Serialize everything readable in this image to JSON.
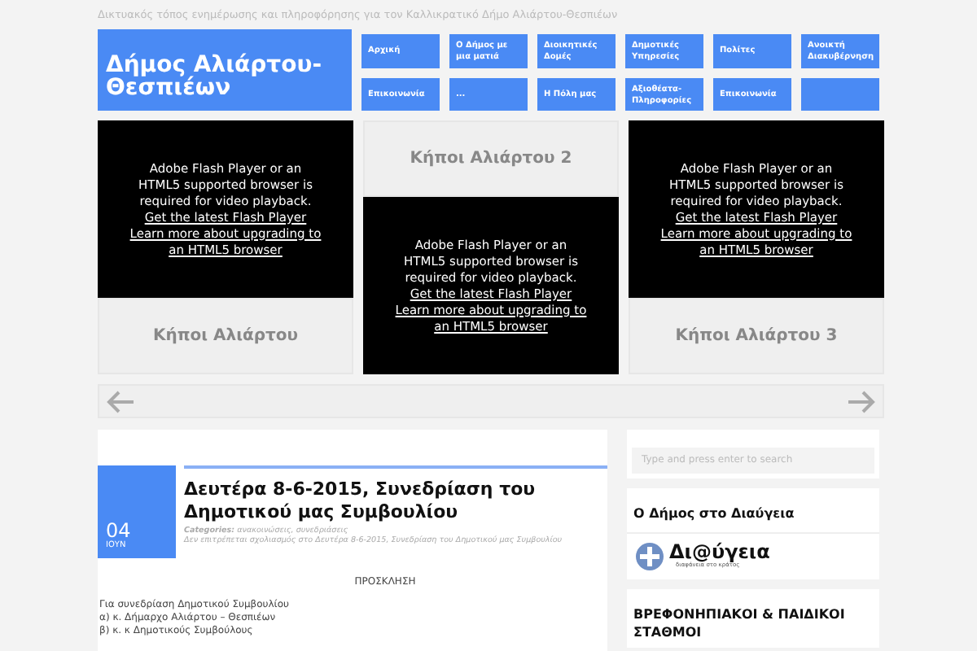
{
  "tagline": "Δικτυακός τόπος ενημέρωσης και πληροφόρησης για τον Καλλικρατικό Δήμο Αλιάρτου-Θεσπιέων",
  "site_title": "Δήμος Αλιάρτου-Θεσπιέων",
  "menu": [
    {
      "kind": "link",
      "label": "Αρχική"
    },
    {
      "kind": "link",
      "label": "Ο Δήμος με μια ματιά"
    },
    {
      "kind": "link",
      "label": "Διοικητικές Δομές"
    },
    {
      "kind": "link",
      "label": "Δημοτικές Υπηρεσίες"
    },
    {
      "kind": "link",
      "label": "Πολίτες"
    },
    {
      "kind": "link",
      "label": "Ανοικτή Διακυβέρνηση"
    },
    {
      "kind": "link",
      "label": "Επικοινωνία"
    },
    {
      "kind": "link",
      "label": "..."
    },
    {
      "kind": "link",
      "label": "Η Πόλη μας"
    },
    {
      "kind": "link",
      "label": "Αξιοθέατα-Πληροφορίες"
    },
    {
      "kind": "link",
      "label": "Επικοινωνία"
    },
    {
      "kind": "blank"
    }
  ],
  "slides": [
    {
      "title": "Κήποι Αλιάρτου",
      "kind": "below",
      "player": {
        "message": "Adobe Flash Player or an HTML5 supported browser is required for video playback.",
        "link_1": "Get the latest Flash Player",
        "link_2": "Learn more about upgrading to an HTML5 browser"
      }
    },
    {
      "title": "Κήποι Αλιάρτου 2",
      "kind": "above",
      "player": {
        "message": "Adobe Flash Player or an HTML5 supported browser is required for video playback.",
        "link_1": "Get the latest Flash Player",
        "link_2": "Learn more about upgrading to an HTML5 browser"
      }
    },
    {
      "title": "Κήποι Αλιάρτου 3",
      "kind": "below",
      "player": {
        "message": "Adobe Flash Player or an HTML5 supported browser is required for video playback.",
        "link_1": "Get the latest Flash Player",
        "link_2": "Learn more about upgrading to an HTML5 browser"
      }
    }
  ],
  "post": {
    "day": "04",
    "month": "ΙΟΥΝ",
    "title": "Δευτέρα 8-6-2015, Συνεδρίαση του Δημοτικού μας Συμβουλίου",
    "categories_label": "Categories:",
    "categories": "ανακοινώσεις, συνεδριάσεις",
    "comments": "Δεν επιτρέπεται σχολιασμός στο Δευτέρα 8-6-2015, Συνεδρίαση του Δημοτικού μας Συμβουλίου",
    "heading": "ΠΡΟΣΚΛΗΣΗ",
    "lines": [
      "Για συνεδρίαση Δημοτικού Συμβουλίου",
      "α) κ. Δήμαρχο Αλιάρτου – Θεσπιέων",
      "β) κ. κ Δημοτικούς Συμβούλους"
    ]
  },
  "sidebar": {
    "search": {
      "placeholder": "Type and press enter to search"
    },
    "widgets": [
      {
        "kind": "logo",
        "title": "Ο Δήμος στο Διαύγεια",
        "logo_text": "Δι@ύγεια",
        "logo_caption": "διαφάνεια στο κράτος"
      },
      {
        "kind": "heading",
        "title": "ΒΡΕΦΟΝΗΠΙΑΚΟΙ & ΠΑΙΔΙΚΟΙ ΣΤΑΘΜΟΙ"
      }
    ]
  }
}
